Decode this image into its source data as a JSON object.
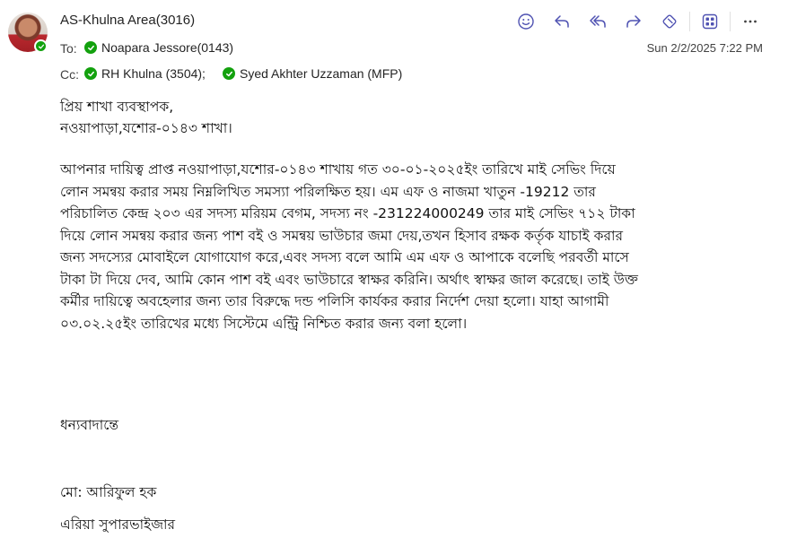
{
  "header": {
    "sender": "AS-Khulna Area(3016)",
    "to_label": "To:",
    "to": [
      {
        "name": "Noapara Jessore(0143)"
      }
    ],
    "cc_label": "Cc:",
    "cc": [
      {
        "name": "RH Khulna (3504);"
      },
      {
        "name": "Syed Akhter Uzzaman (MFP)"
      }
    ],
    "date": "Sun 2/2/2025 7:22 PM"
  },
  "toolbar": {
    "icons": [
      "emoji-icon",
      "reply-icon",
      "reply-all-icon",
      "forward-icon",
      "sticker-icon",
      "apps-icon",
      "more-icon"
    ],
    "accent": "#4f52b2"
  },
  "body": {
    "greeting_1": "প্রিয় শাখা ব্যবস্থাপক,",
    "greeting_2": "নওয়াপাড়া,যশোর-০১৪৩ শাখা।",
    "lines": [
      "আপনার দায়িত্ব প্রাপ্ত  নওয়াপাড়া,যশোর-০১৪৩ শাখায়  গত ৩০-০১-২০২৫ইং তারিখে মাই সেভিং দিয়ে",
      "লোন সমন্বয় করার সময় নিম্নলিখিত সমস্যা পরিলক্ষিত হয়। এম এফ ও নাজমা খাতুন  -19212 তার",
      "পরিচালিত কেন্দ্র ২০৩ এর সদস্য  মরিয়ম বেগম, সদস্য নং -231224000249 তার মাই সেভিং  ৭১২ টাকা",
      "দিয়ে লোন সমন্বয় করার জন্য পাশ বই ও সমন্বয় ভাউচার  জমা দেয়,তখন হিসাব রক্ষক কর্তৃক  যাচাই করার",
      "জন্য সদস্যের মোবাইলে যোগাযোগ করে,এবং সদস্য বলে আমি এম এফ ও আপাকে বলেছি পরবর্তী মাসে",
      "টাকা টা দিয়ে দেব, আমি কোন পাশ বই এবং ভাউচারে স্বাক্ষর করিনি। অর্থাৎ স্বাক্ষর জাল করেছে। তাই উক্ত",
      "কর্মীর দায়িত্বে অবহেলার জন্য তার বিরুদ্ধে দন্ড পলিসি কার্যকর করার নির্দেশ দেয়া হলো। যাহা আগামী",
      "০৩.০২.২৫ইং তারিখের মধ্যে সিস্টেমে এন্ট্রি নিশ্চিত করার জন্য বলা হলো।"
    ],
    "closing": "ধন্যবাদান্তে",
    "signature_name": "মো: আরিফুল হক",
    "signature_title": "এরিয়া সুপারভাইজার"
  }
}
